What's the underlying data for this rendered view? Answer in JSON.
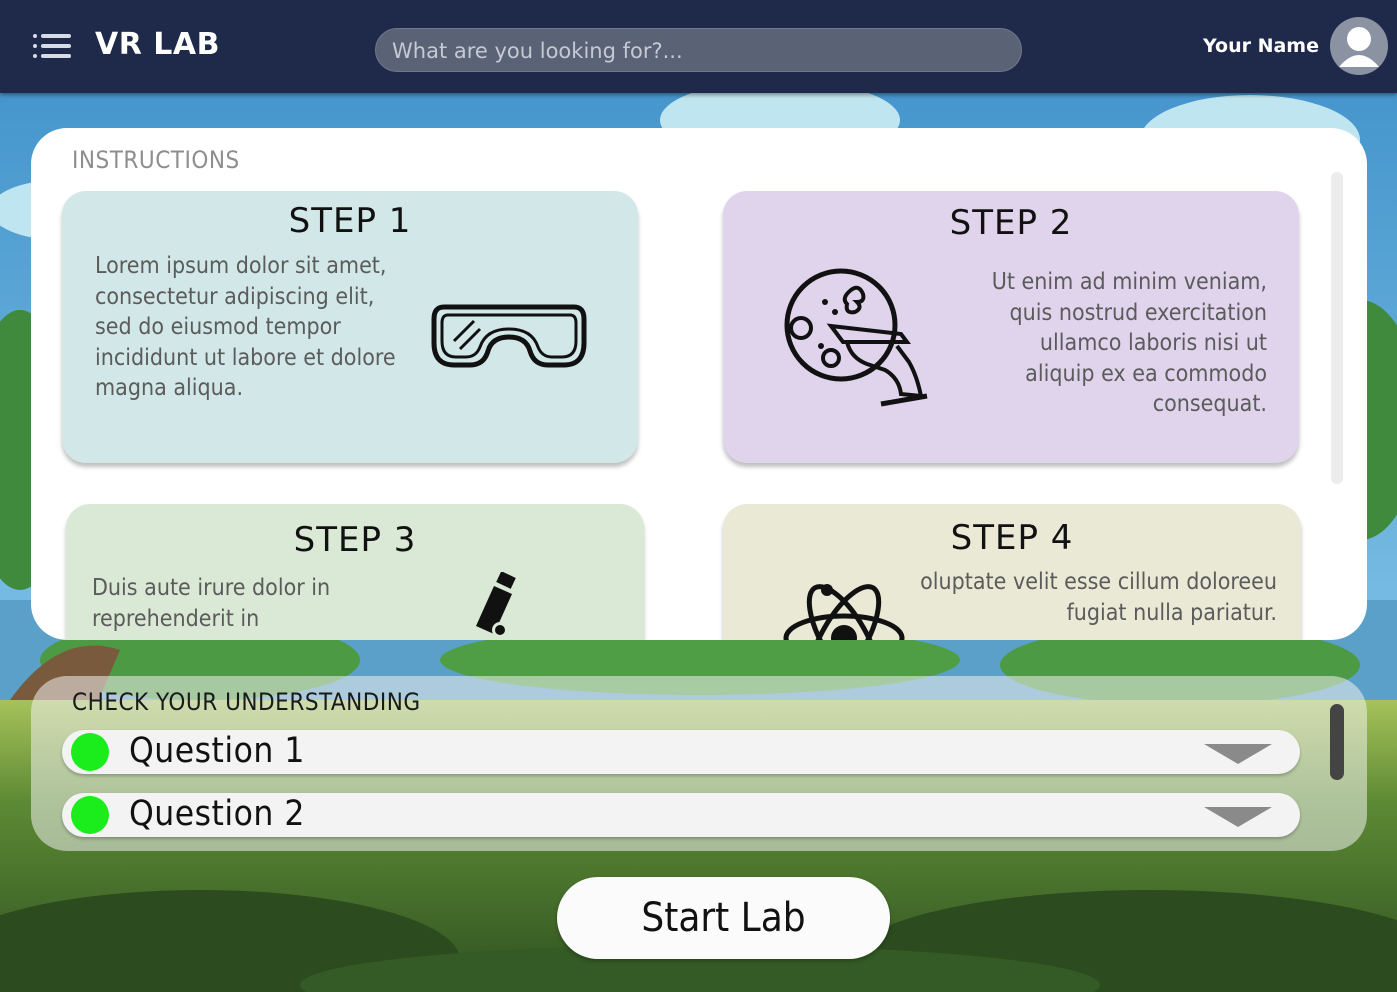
{
  "header": {
    "brand": "VR LAB",
    "search_placeholder": "What are you looking for?...",
    "user_name": "Your Name"
  },
  "instructions": {
    "title": "INSTRUCTIONS",
    "steps": [
      {
        "title": "STEP 1",
        "text": "Lorem ipsum dolor sit amet, consectetur adipiscing elit, sed do eiusmod tempor incididunt ut labore et dolore magna aliqua.",
        "icon": "safety-goggles-icon",
        "color": "#d2e8e8"
      },
      {
        "title": "STEP 2",
        "text": "Ut enim ad minim veniam, quis nostrud exercitation ullamco laboris nisi ut aliquip ex ea commodo consequat.",
        "icon": "petri-dish-icon",
        "color": "#e0d3ec"
      },
      {
        "title": "STEP 3",
        "text": "Duis aute irure dolor in reprehenderit in",
        "icon": "microscope-icon",
        "color": "#dae8d6"
      },
      {
        "title": "STEP 4",
        "text": "oluptate velit esse cillum doloreeu fugiat nulla pariatur.",
        "icon": "atom-icon",
        "color": "#e9e9d6"
      }
    ]
  },
  "check": {
    "title": "CHECK YOUR UNDERSTANDING",
    "questions": [
      {
        "label": "Question 1",
        "status_color": "#1bec1b"
      },
      {
        "label": "Question 2",
        "status_color": "#1bec1b"
      }
    ]
  },
  "start_button": "Start Lab"
}
